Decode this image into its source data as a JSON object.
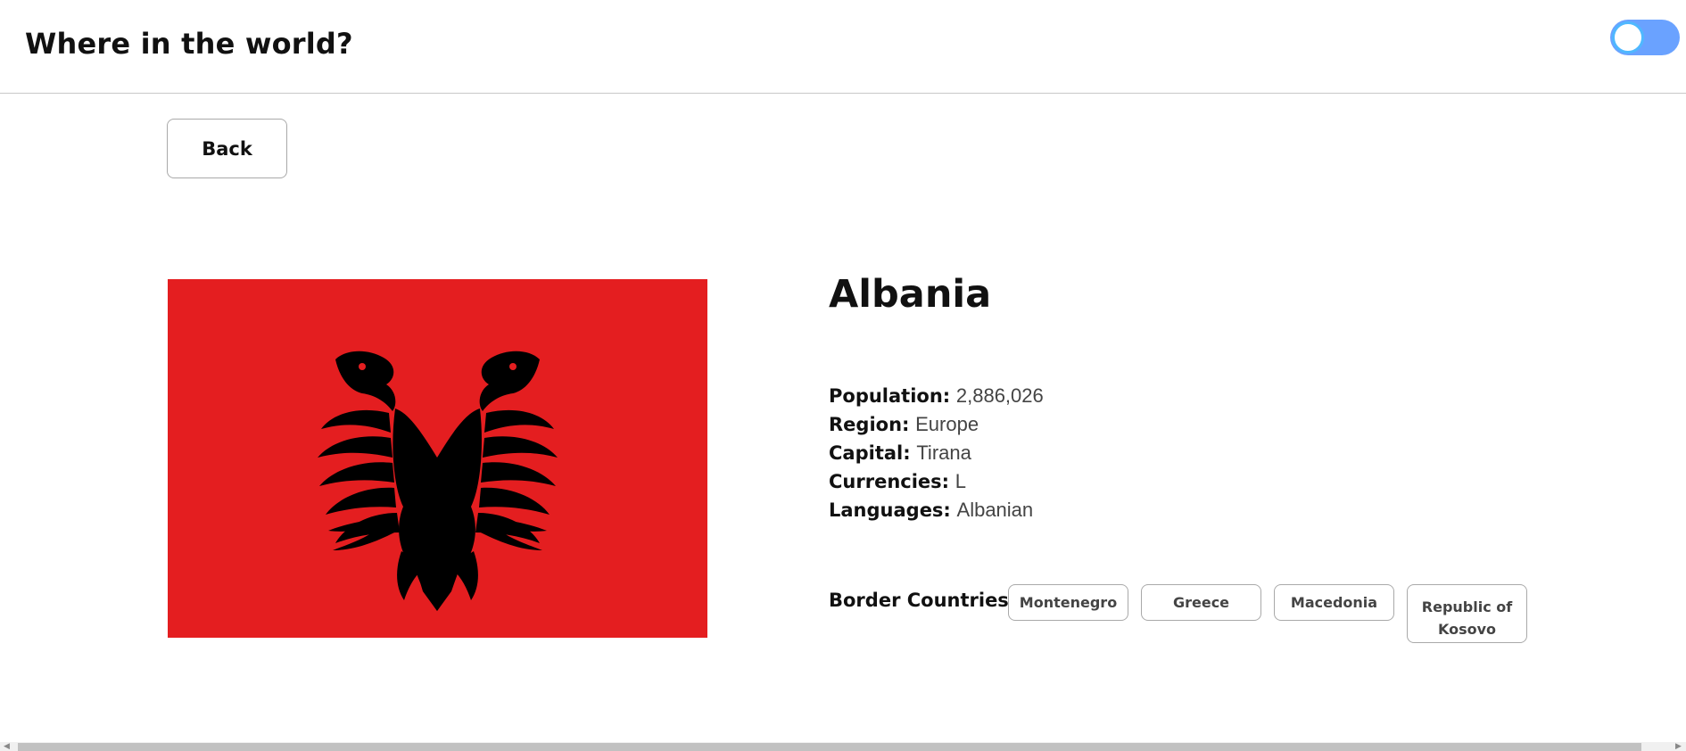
{
  "header": {
    "title": "Where in the world?",
    "theme_toggle": {
      "state": "on",
      "color": "#6aa2ff"
    }
  },
  "nav": {
    "back_label": "Back"
  },
  "country": {
    "name": "Albania",
    "flag": {
      "background": "#e41e20",
      "emblem": "double-headed-eagle",
      "emblem_color": "#000000"
    },
    "facts": [
      {
        "label": "Population:",
        "value": "2,886,026"
      },
      {
        "label": "Region:",
        "value": "Europe"
      },
      {
        "label": "Capital:",
        "value": "Tirana"
      },
      {
        "label": "Currencies:",
        "value": "L"
      },
      {
        "label": "Languages:",
        "value": "Albanian"
      }
    ],
    "border_label": "Border Countries:",
    "borders": [
      "Montenegro",
      "Greece",
      "Macedonia",
      "Republic of Kosovo"
    ]
  }
}
